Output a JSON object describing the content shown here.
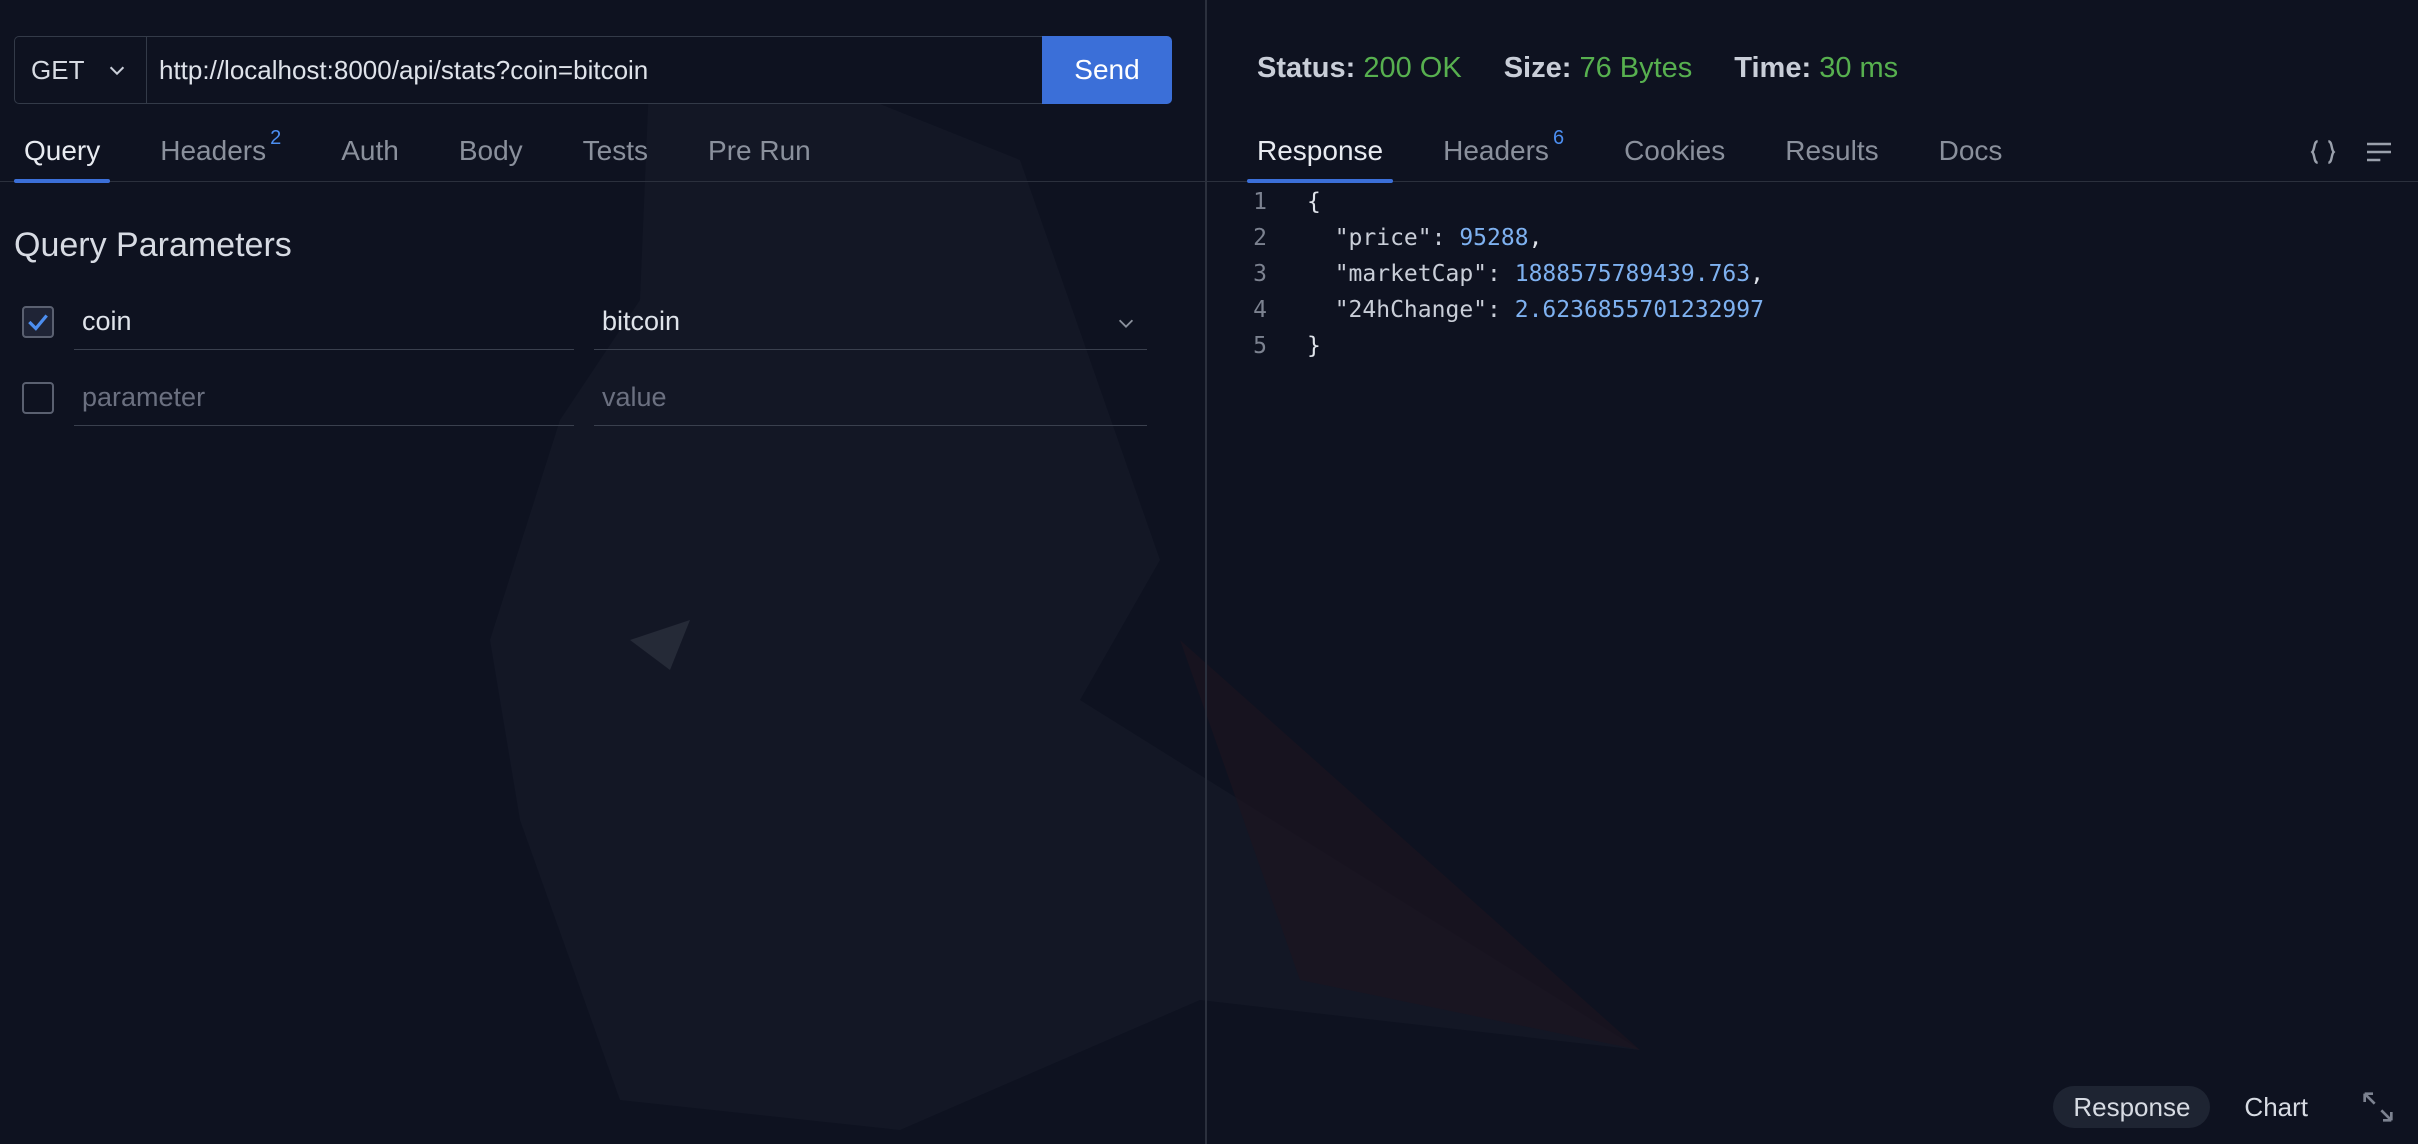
{
  "request": {
    "method": "GET",
    "url": "http://localhost:8000/api/stats?coin=bitcoin",
    "send_label": "Send"
  },
  "request_tabs": [
    {
      "label": "Query",
      "badge": "",
      "active": true
    },
    {
      "label": "Headers",
      "badge": "2",
      "active": false
    },
    {
      "label": "Auth",
      "badge": "",
      "active": false
    },
    {
      "label": "Body",
      "badge": "",
      "active": false
    },
    {
      "label": "Tests",
      "badge": "",
      "active": false
    },
    {
      "label": "Pre Run",
      "badge": "",
      "active": false
    }
  ],
  "query": {
    "title": "Query Parameters",
    "params": [
      {
        "key": "coin",
        "value": "bitcoin",
        "checked": true
      },
      {
        "key_placeholder": "parameter",
        "value_placeholder": "value",
        "checked": false
      }
    ]
  },
  "response_status": {
    "status_label": "Status:",
    "status_value": "200 OK",
    "size_label": "Size:",
    "size_value": "76 Bytes",
    "time_label": "Time:",
    "time_value": "30 ms"
  },
  "response_tabs": [
    {
      "label": "Response",
      "badge": "",
      "active": true
    },
    {
      "label": "Headers",
      "badge": "6",
      "active": false
    },
    {
      "label": "Cookies",
      "badge": "",
      "active": false
    },
    {
      "label": "Results",
      "badge": "",
      "active": false
    },
    {
      "label": "Docs",
      "badge": "",
      "active": false
    }
  ],
  "response_body": {
    "lines": [
      {
        "num": "1",
        "parts": [
          {
            "t": "{",
            "c": "p"
          }
        ]
      },
      {
        "num": "2",
        "parts": [
          {
            "t": "  \"price\": ",
            "c": "k"
          },
          {
            "t": "95288",
            "c": "n"
          },
          {
            "t": ",",
            "c": "p"
          }
        ]
      },
      {
        "num": "3",
        "parts": [
          {
            "t": "  \"marketCap\": ",
            "c": "k"
          },
          {
            "t": "1888575789439.763",
            "c": "n"
          },
          {
            "t": ",",
            "c": "p"
          }
        ]
      },
      {
        "num": "4",
        "parts": [
          {
            "t": "  \"24hChange\": ",
            "c": "k"
          },
          {
            "t": "2.6236855701232997",
            "c": "n"
          }
        ]
      },
      {
        "num": "5",
        "parts": [
          {
            "t": "}",
            "c": "p"
          }
        ]
      }
    ]
  },
  "bottom_bar": {
    "response_label": "Response",
    "chart_label": "Chart"
  },
  "icons": {
    "format": "braces-icon",
    "wrap": "wrap-lines-icon",
    "expand": "expand-icon"
  },
  "colors": {
    "background": "#0e1220",
    "accent": "#3b6fd8",
    "success": "#57b04f",
    "number": "#7eb1f0"
  }
}
